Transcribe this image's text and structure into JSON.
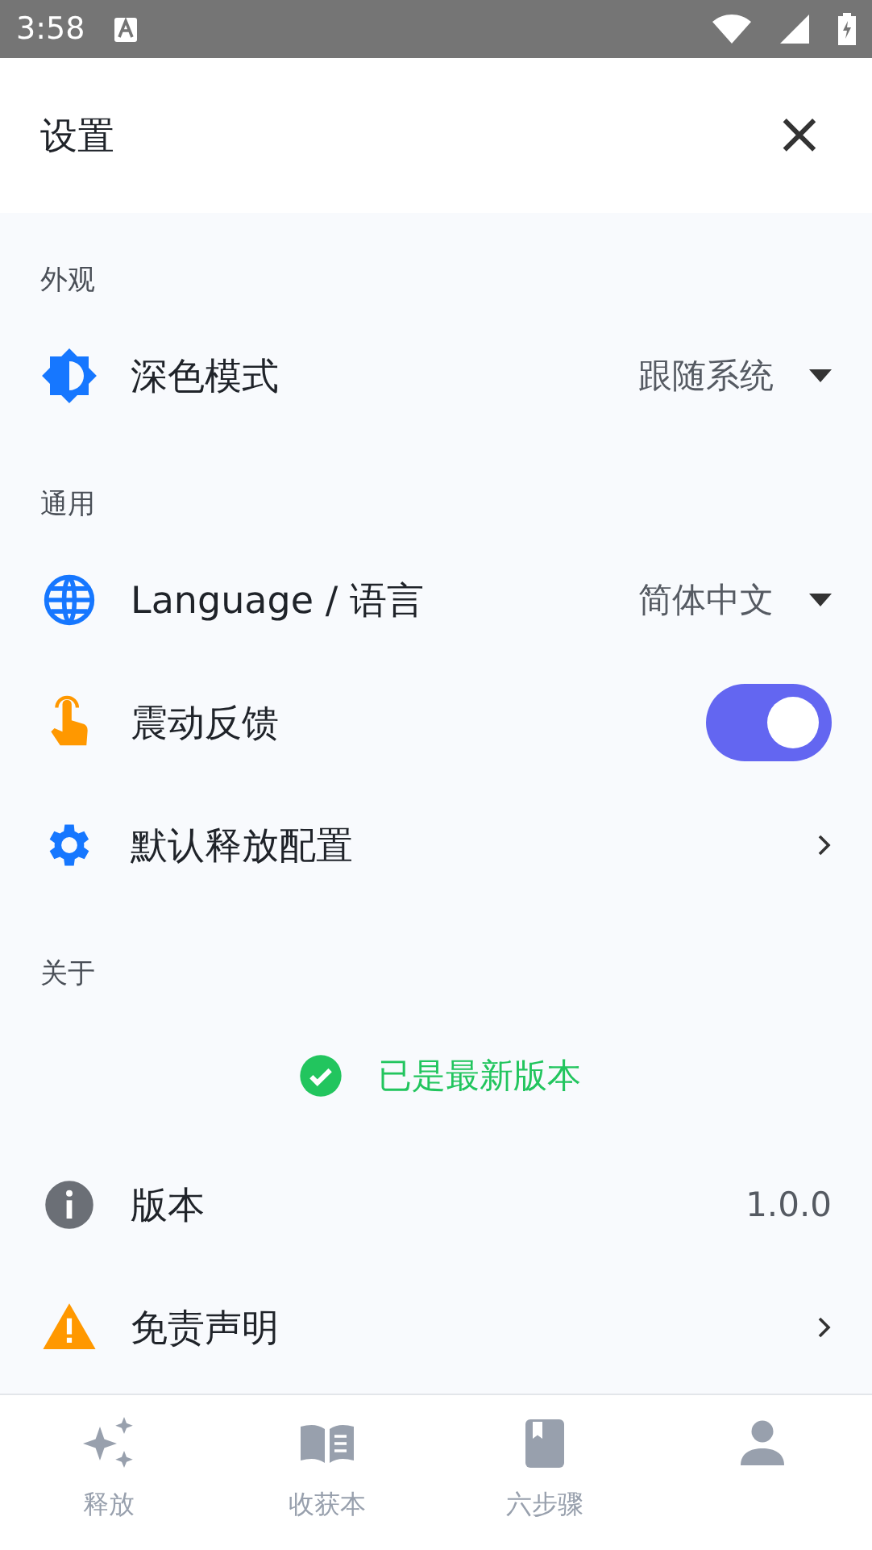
{
  "status_bar": {
    "time": "3:58"
  },
  "header": {
    "title": "设置",
    "close": "×"
  },
  "sections": [
    {
      "title": "外观",
      "items": [
        {
          "kind": "dropdown",
          "label": "深色模式",
          "value": "跟随系统"
        }
      ]
    },
    {
      "title": "通用",
      "items": [
        {
          "kind": "dropdown",
          "label": "Language / 语言",
          "value": "简体中文"
        },
        {
          "kind": "toggle",
          "label": "震动反馈",
          "on": true
        },
        {
          "kind": "link",
          "label": "默认释放配置"
        }
      ]
    },
    {
      "title": "关于",
      "items": [
        {
          "kind": "status",
          "label": "已是最新版本"
        },
        {
          "kind": "value",
          "label": "版本",
          "value": "1.0.0"
        },
        {
          "kind": "link",
          "label": "免责声明"
        }
      ]
    }
  ],
  "bottom_nav": [
    {
      "label": "释放",
      "selected": false
    },
    {
      "label": "收获本",
      "selected": false
    },
    {
      "label": "六步骤",
      "selected": false
    },
    {
      "selected": false
    }
  ]
}
